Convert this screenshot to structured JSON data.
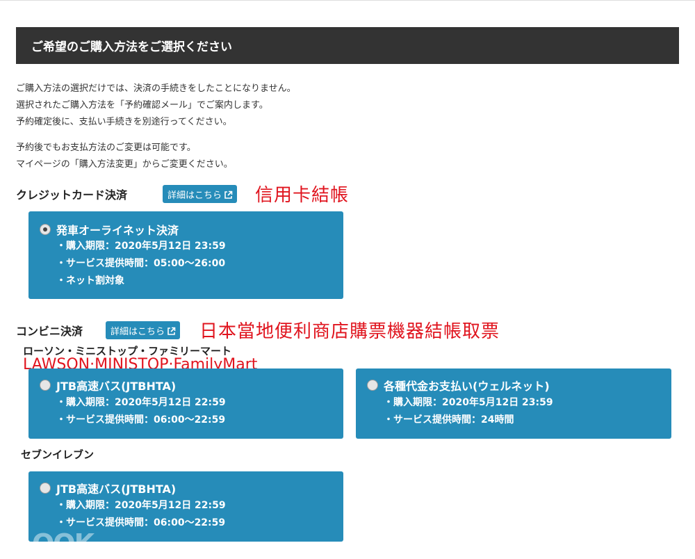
{
  "header": {
    "title": "ご希望のご購入方法をご選択ください"
  },
  "intro": {
    "block1": [
      "ご購入方法の選択だけでは、決済の手続きをしたことになりません。",
      "選択されたご購入方法を「予約確認メール」でご案内します。",
      "予約確定後に、支払い手続きを別途行ってください。"
    ],
    "block2": [
      "予約後でもお支払方法のご変更は可能です。",
      "マイページの「購入方法変更」からご変更ください。"
    ]
  },
  "credit": {
    "title": "クレジットカード決済",
    "link_label": "詳細はこちら",
    "annotation": "信用卡結帳",
    "card": {
      "title": "発車オーライネット決済",
      "selected": true,
      "details": [
        "購入期限：2020年5月12日 23:59",
        "サービス提供時間：05:00〜26:00",
        "ネット割対象"
      ]
    }
  },
  "convenience": {
    "title": "コンビニ決済",
    "link_label": "詳細はこちら",
    "annotation": "日本當地便利商店購票機器結帳取票",
    "group1": {
      "label": "ローソン・ミニストップ・ファミリーマート",
      "annotation": "LAWSON·MINISTOP·FamilyMart",
      "cards": [
        {
          "title": "JTB高速バス(JTBHTA)",
          "selected": false,
          "details": [
            "購入期限：2020年5月12日 22:59",
            "サービス提供時間：06:00〜22:59"
          ]
        },
        {
          "title": "各種代金お支払い(ウェルネット)",
          "selected": false,
          "details": [
            "購入期限：2020年5月12日 23:59",
            "サービス提供時間：24時間"
          ]
        }
      ]
    },
    "group2": {
      "label": "セブンイレブン",
      "cards": [
        {
          "title": "JTB高速バス(JTBHTA)",
          "selected": false,
          "details": [
            "購入期限：2020年5月12日 22:59",
            "サービス提供時間：06:00〜22:59"
          ]
        }
      ]
    }
  },
  "watermark": "OOK",
  "colors": {
    "card_blue": "#268cb9",
    "header_dark": "#333333",
    "annotation_red": "#e0141e"
  }
}
